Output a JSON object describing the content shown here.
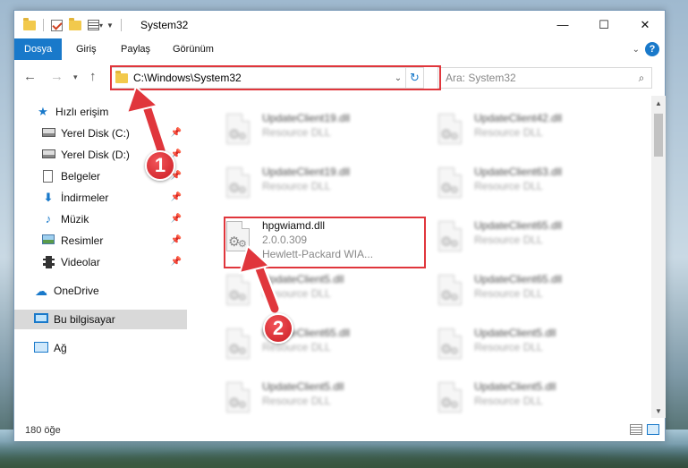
{
  "window": {
    "title": "System32",
    "controls": {
      "minimize": "—",
      "maximize": "☐",
      "close": "✕"
    }
  },
  "ribbon": {
    "tabs": [
      {
        "label": "Dosya",
        "active": true
      },
      {
        "label": "Giriş",
        "active": false
      },
      {
        "label": "Paylaş",
        "active": false
      },
      {
        "label": "Görünüm",
        "active": false
      }
    ],
    "help": "?"
  },
  "navigation": {
    "address_path": "C:\\Windows\\System32",
    "search_placeholder": "Ara: System32"
  },
  "nav_pane": {
    "items": [
      {
        "label": "Hızlı erişim",
        "icon": "star-icon"
      },
      {
        "label": "Yerel Disk (C:)",
        "icon": "drive-icon",
        "pinned": true
      },
      {
        "label": "Yerel Disk (D:)",
        "icon": "drive-icon",
        "pinned": true
      },
      {
        "label": "Belgeler",
        "icon": "documents-icon",
        "pinned": true
      },
      {
        "label": "İndirmeler",
        "icon": "downloads-icon",
        "pinned": true
      },
      {
        "label": "Müzik",
        "icon": "music-icon",
        "pinned": true
      },
      {
        "label": "Resimler",
        "icon": "pictures-icon",
        "pinned": true
      },
      {
        "label": "Videolar",
        "icon": "videos-icon",
        "pinned": true
      },
      {
        "label": "OneDrive",
        "icon": "onedrive-icon"
      },
      {
        "label": "Bu bilgisayar",
        "icon": "this-pc-icon",
        "selected": true
      },
      {
        "label": "Ağ",
        "icon": "network-icon"
      }
    ]
  },
  "files": {
    "col1": [
      {
        "name": "UpdateClient19.dll",
        "type": "Resource DLL"
      },
      {
        "name": "UpdateClient19.dll",
        "type": "Resource DLL"
      },
      {
        "name": "hpgwiamd.dll",
        "version": "2.0.0.309",
        "company": "Hewlett-Packard WIA..."
      },
      {
        "name": "UpdateClient5.dll",
        "type": "Resource DLL"
      },
      {
        "name": "UpdateClient65.dll",
        "type": "Resource DLL"
      },
      {
        "name": "UpdateClient5.dll",
        "type": "Resource DLL"
      }
    ],
    "col2": [
      {
        "name": "UpdateClient42.dll",
        "type": "Resource DLL"
      },
      {
        "name": "UpdateClient63.dll",
        "type": "Resource DLL"
      },
      {
        "name": "UpdateClient65.dll",
        "type": "Resource DLL"
      },
      {
        "name": "UpdateClient65.dll",
        "type": "Resource DLL"
      },
      {
        "name": "UpdateClient5.dll",
        "type": "Resource DLL"
      },
      {
        "name": "UpdateClient5.dll",
        "type": "Resource DLL"
      }
    ]
  },
  "status": {
    "item_count": "180 öğe"
  },
  "annotations": {
    "step1": "1",
    "step2": "2",
    "color": "#e0363c"
  }
}
